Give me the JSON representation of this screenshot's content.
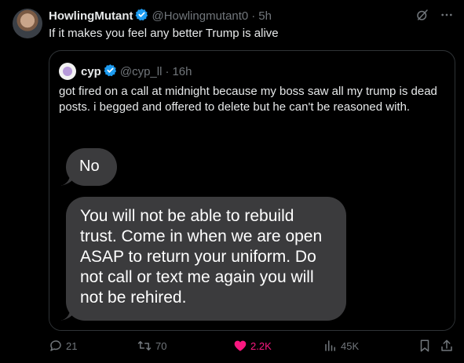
{
  "post": {
    "display_name": "HowlingMutant",
    "handle": "@Howlingmutant0",
    "separator": "·",
    "time": "5h",
    "text": "If it makes you feel any better Trump is alive"
  },
  "quote": {
    "display_name": "cyp",
    "handle": "@cyp_ll",
    "separator": "·",
    "time": "16h",
    "text": "got fired on a call at midnight because my boss saw all my trump is dead posts. i begged and offered to delete but he can't be reasoned with.",
    "messages": [
      {
        "text": "No"
      },
      {
        "text": "You will not be able to rebuild trust. Come in when we are open ASAP to return your uniform. Do not call or text me again you will not be rehired."
      }
    ]
  },
  "actions": {
    "replies": "21",
    "reposts": "70",
    "likes": "2.2K",
    "views": "45K"
  },
  "colors": {
    "background": "#000000",
    "text": "#e7e9ea",
    "muted": "#71767b",
    "verified": "#1d9bf0",
    "like": "#f91880",
    "bubble": "#3b3b3d",
    "border": "#2f3336"
  },
  "icons": [
    "verified-badge-icon",
    "grok-icon",
    "more-icon",
    "reply-icon",
    "repost-icon",
    "heart-icon",
    "views-icon",
    "bookmark-icon",
    "share-icon"
  ]
}
